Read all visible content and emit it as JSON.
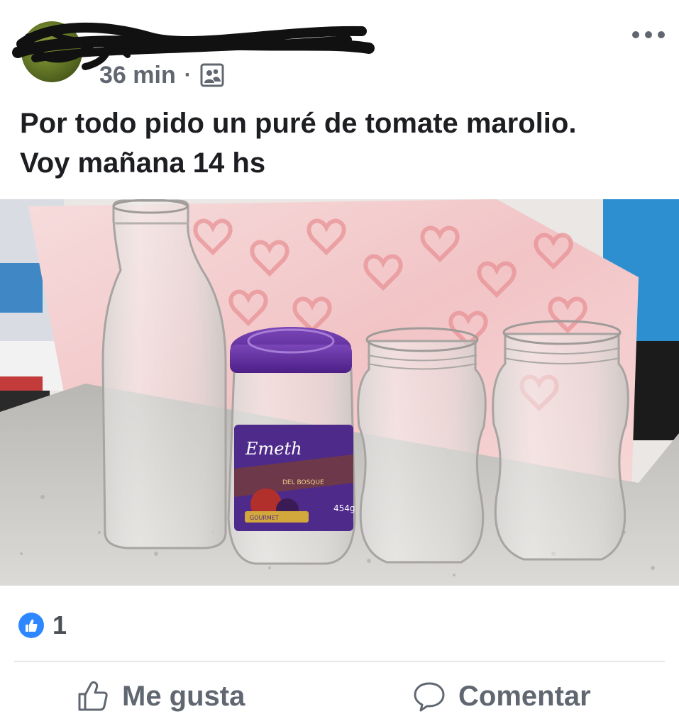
{
  "post": {
    "time": "36 min",
    "separator": "·",
    "text_line1": "Por todo pido un puré de tomate marolio.",
    "text_line2": "Voy mañana 14 hs",
    "photo": {
      "jar_label_brand": "Emeth",
      "jar_label_line": "DEL BOSQUE",
      "jar_label_weight": "454g",
      "jar_label_gourmet": "GOURMET"
    }
  },
  "reactions": {
    "count": "1",
    "icon": "like-icon",
    "color": "#2d88ff"
  },
  "actions": {
    "like_label": "Me gusta",
    "comment_label": "Comentar"
  },
  "icons": {
    "more": "more-options-icon",
    "audience": "friends-audience-icon",
    "like": "thumbs-up-outline-icon",
    "comment": "comment-bubble-icon"
  }
}
